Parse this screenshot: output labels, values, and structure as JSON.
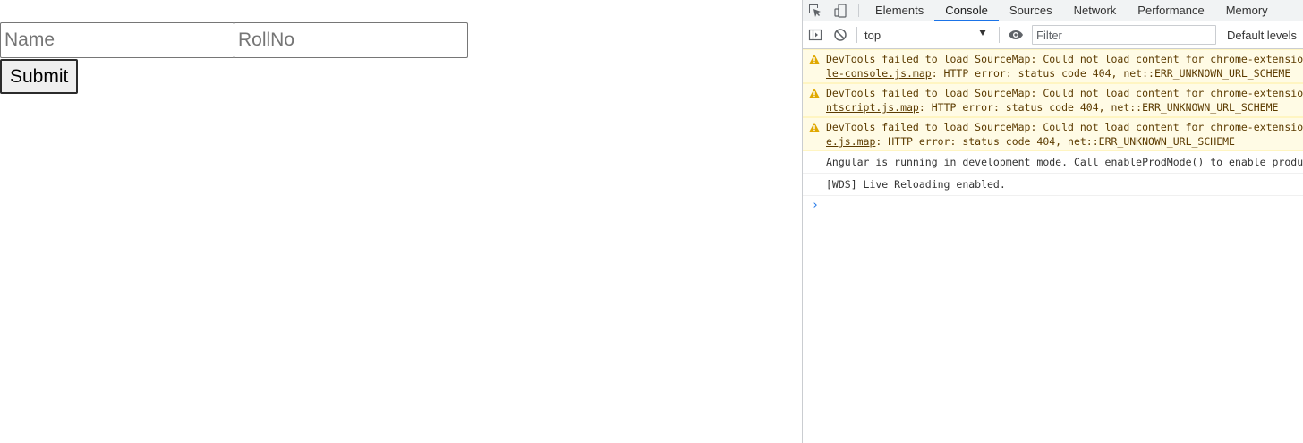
{
  "app": {
    "name_placeholder": "Name",
    "rollno_placeholder": "RollNo",
    "submit_label": "Submit"
  },
  "devtools": {
    "tabs": [
      {
        "label": "Elements",
        "active": false
      },
      {
        "label": "Console",
        "active": true
      },
      {
        "label": "Sources",
        "active": false
      },
      {
        "label": "Network",
        "active": false
      },
      {
        "label": "Performance",
        "active": false
      },
      {
        "label": "Memory",
        "active": false
      }
    ],
    "toolbar": {
      "context": "top",
      "filter_placeholder": "Filter",
      "levels_label": "Default levels"
    },
    "messages": [
      {
        "type": "warning",
        "line1_text": "DevTools failed to load SourceMap: Could not load content for ",
        "line1_link": "chrome-extension://.../",
        "line2_link": "le-console.js.map",
        "line2_text": ": HTTP error: status code 404, net::ERR_UNKNOWN_URL_SCHEME"
      },
      {
        "type": "warning",
        "line1_text": "DevTools failed to load SourceMap: Could not load content for ",
        "line1_link": "chrome-extension://.../",
        "line2_link": "ntscript.js.map",
        "line2_text": ": HTTP error: status code 404, net::ERR_UNKNOWN_URL_SCHEME"
      },
      {
        "type": "warning",
        "line1_text": "DevTools failed to load SourceMap: Could not load content for ",
        "line1_link": "chrome-extension://.../",
        "line2_link": "e.js.map",
        "line2_text": ": HTTP error: status code 404, net::ERR_UNKNOWN_URL_SCHEME"
      },
      {
        "type": "info",
        "text": "Angular is running in development mode. Call enableProdMode() to enable production mode."
      },
      {
        "type": "info",
        "text": "[WDS] Live Reloading enabled."
      }
    ],
    "prompt_symbol": "›",
    "colors": {
      "accent": "#1a73e8",
      "warning_bg": "#fffbe5",
      "warning_text": "#5c3b00",
      "warning_icon": "#e0a800"
    }
  }
}
